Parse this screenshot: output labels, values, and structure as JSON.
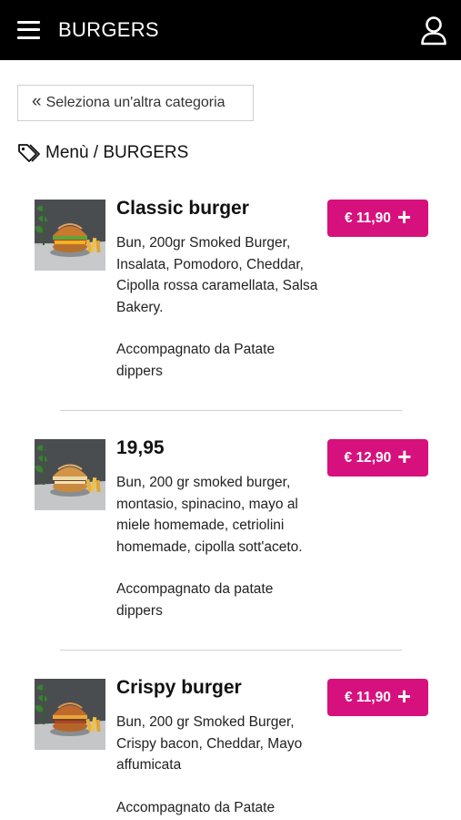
{
  "header": {
    "title": "BURGERS",
    "menu_icon": "hamburger-menu-icon",
    "user_icon": "user-icon"
  },
  "back_button": {
    "icon": "double-chevron-left-icon",
    "label": "Seleziona un'altra categoria"
  },
  "breadcrumb": {
    "icon": "tag-icon",
    "text": "Menù / BURGERS"
  },
  "colors": {
    "accent": "#d6117d",
    "header_bg": "#000000"
  },
  "products": [
    {
      "name": "Classic burger",
      "description": "Bun, 200gr Smoked Burger, Insalata, Pomodoro, Cheddar, Cipolla rossa caramellata, Salsa Bakery.",
      "side": "Accompagnato da Patate dippers",
      "price": "€ 11,90",
      "add_icon": "plus-icon"
    },
    {
      "name": "19,95",
      "description": "Bun, 200 gr smoked burger, montasio, spinacino, mayo al miele homemade, cetriolini homemade, cipolla sott'aceto.",
      "side": "Accompagnato da patate dippers",
      "price": "€ 12,90",
      "add_icon": "plus-icon"
    },
    {
      "name": "Crispy burger",
      "description": "Bun, 200 gr Smoked Burger, Crispy bacon, Cheddar, Mayo affumicata",
      "side": "Accompagnato da Patate",
      "price": "€ 11,90",
      "add_icon": "plus-icon"
    }
  ]
}
